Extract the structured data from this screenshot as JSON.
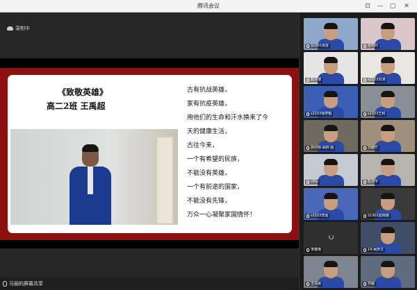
{
  "window": {
    "title": "腾讯会议"
  },
  "status": {
    "recording": "录制中"
  },
  "slide": {
    "title": "《致敬英雄》",
    "subtitle": "高二2班   王禹超",
    "poem": [
      "古有抗战英雄，",
      "家有抗疫英雄，",
      "用他们的生命和汗水换来了今",
      "天的健康生活，",
      "古往今来，",
      "一个有希望的民族，",
      "不能没有英雄，",
      "一个有前途的国家，",
      "不能没有先锋，",
      "万众一心凝聚家国情怀！"
    ]
  },
  "bottom": {
    "share_label": "马丽的屏幕共享"
  },
  "participants": [
    {
      "name": "S1901张苗",
      "bg": "#8fa7c9"
    },
    {
      "name": "张可欣",
      "bg": "#d9c7c9"
    },
    {
      "name": "赵子博",
      "bg": "#e5e5e5"
    },
    {
      "name": "s2103刘涛",
      "bg": "#e9e7e2"
    },
    {
      "name": "s2103徐梦魁",
      "bg": "#3b5fb5"
    },
    {
      "name": "s2103王和",
      "bg": "#8a8f96"
    },
    {
      "name": "高中部-胡黔·圆",
      "bg": "#6e6a60"
    },
    {
      "name": "刘雨竹",
      "bg": "#9f8f7d"
    },
    {
      "name": "cHiu",
      "bg": "#c5c9d2"
    },
    {
      "name": "杜汶宇",
      "bg": "#b7b4ad"
    },
    {
      "name": "s2103李嘉",
      "bg": "#4b67b8"
    },
    {
      "name": "S1901赵晓傲",
      "bg": "#3a3a3a"
    },
    {
      "name": "李春雨",
      "bg": "#2f2f2f"
    },
    {
      "name": "14-吴彦文",
      "bg": "#3f4d66"
    },
    {
      "name": "王先晨",
      "bg": "#7d8591"
    },
    {
      "name": "齐聪",
      "bg": "#5f6c80"
    }
  ]
}
